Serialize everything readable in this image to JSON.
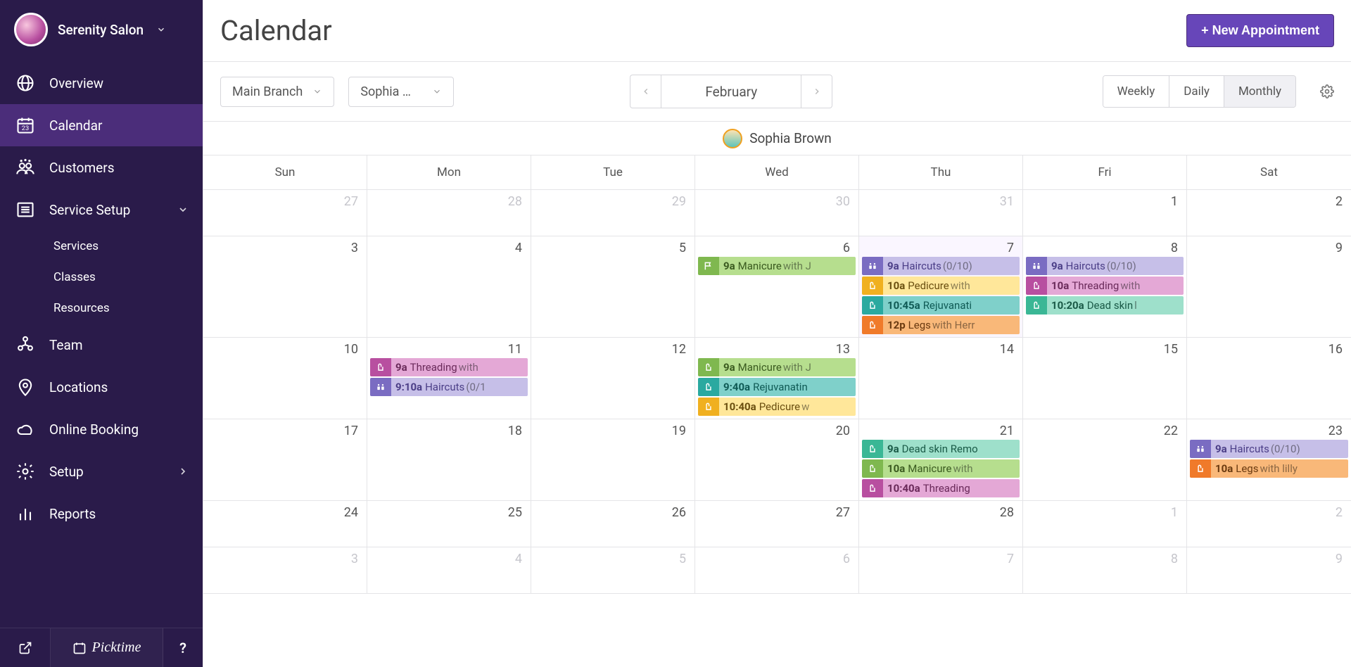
{
  "brand": {
    "name": "Serenity Salon"
  },
  "sidebar": {
    "items": [
      {
        "label": "Overview",
        "icon": "globe"
      },
      {
        "label": "Calendar",
        "icon": "calendar",
        "active": true
      },
      {
        "label": "Customers",
        "icon": "customers"
      },
      {
        "label": "Service Setup",
        "icon": "service",
        "expandable": true,
        "expanded": true
      },
      {
        "label": "Team",
        "icon": "team"
      },
      {
        "label": "Locations",
        "icon": "location"
      },
      {
        "label": "Online Booking",
        "icon": "cloud"
      },
      {
        "label": "Setup",
        "icon": "gear",
        "expandable": true
      },
      {
        "label": "Reports",
        "icon": "reports"
      }
    ],
    "sub": [
      {
        "label": "Services"
      },
      {
        "label": "Classes"
      },
      {
        "label": "Resources"
      }
    ],
    "footer_brand": "Picktime"
  },
  "header": {
    "title": "Calendar",
    "new_appointment": "+ New Appointment"
  },
  "filters": {
    "branch": "Main Branch",
    "staff": "Sophia …",
    "month": "February",
    "views": [
      "Weekly",
      "Daily",
      "Monthly"
    ],
    "active_view": "Monthly"
  },
  "staff_bar": {
    "name": "Sophia Brown"
  },
  "calendar": {
    "day_headers": [
      "Sun",
      "Mon",
      "Tue",
      "Wed",
      "Thu",
      "Fri",
      "Sat"
    ],
    "weeks": [
      [
        {
          "n": "27",
          "muted": true
        },
        {
          "n": "28",
          "muted": true
        },
        {
          "n": "29",
          "muted": true
        },
        {
          "n": "30",
          "muted": true
        },
        {
          "n": "31",
          "muted": true
        },
        {
          "n": "1"
        },
        {
          "n": "2"
        }
      ],
      [
        {
          "n": "3"
        },
        {
          "n": "4"
        },
        {
          "n": "5"
        },
        {
          "n": "6",
          "events": [
            {
              "c": "green",
              "i": "flag",
              "t": "9a",
              "x": "Manicure",
              "w": "with J"
            }
          ]
        },
        {
          "n": "7",
          "today": true,
          "events": [
            {
              "c": "lav",
              "i": "class",
              "t": "9a",
              "x": "Haircuts",
              "w": "(0/10)"
            },
            {
              "c": "yellow",
              "i": "thumb",
              "t": "10a",
              "x": "Pedicure",
              "w": "with"
            },
            {
              "c": "teal",
              "i": "thumb",
              "t": "10:45a",
              "x": "Rejuvanati",
              "w": ""
            },
            {
              "c": "orange",
              "i": "thumb",
              "t": "12p",
              "x": "Legs",
              "w": "with Herr"
            }
          ]
        },
        {
          "n": "8",
          "events": [
            {
              "c": "lav",
              "i": "class",
              "t": "9a",
              "x": "Haircuts",
              "w": "(0/10)"
            },
            {
              "c": "mag",
              "i": "thumb",
              "t": "10a",
              "x": "Threading",
              "w": "with"
            },
            {
              "c": "mint",
              "i": "thumb",
              "t": "10:20a",
              "x": "Dead skin",
              "w": "l"
            }
          ]
        },
        {
          "n": "9"
        }
      ],
      [
        {
          "n": "10"
        },
        {
          "n": "11",
          "events": [
            {
              "c": "mag",
              "i": "thumb",
              "t": "9a",
              "x": "Threading",
              "w": "with"
            },
            {
              "c": "lav",
              "i": "class",
              "t": "9:10a",
              "x": "Haircuts",
              "w": "(0/1"
            }
          ]
        },
        {
          "n": "12"
        },
        {
          "n": "13",
          "events": [
            {
              "c": "green",
              "i": "thumb",
              "t": "9a",
              "x": "Manicure",
              "w": "with J"
            },
            {
              "c": "teal",
              "i": "thumb",
              "t": "9:40a",
              "x": "Rejuvanatin",
              "w": ""
            },
            {
              "c": "yellow",
              "i": "thumb",
              "t": "10:40a",
              "x": "Pedicure",
              "w": "w"
            }
          ]
        },
        {
          "n": "14"
        },
        {
          "n": "15"
        },
        {
          "n": "16"
        }
      ],
      [
        {
          "n": "17"
        },
        {
          "n": "18"
        },
        {
          "n": "19"
        },
        {
          "n": "20"
        },
        {
          "n": "21",
          "events": [
            {
              "c": "mint",
              "i": "thumb",
              "t": "9a",
              "x": "Dead skin Remo",
              "w": ""
            },
            {
              "c": "green",
              "i": "thumb",
              "t": "10a",
              "x": "Manicure",
              "w": "with"
            },
            {
              "c": "mag",
              "i": "thumb",
              "t": "10:40a",
              "x": "Threading",
              "w": ""
            }
          ]
        },
        {
          "n": "22"
        },
        {
          "n": "23",
          "events": [
            {
              "c": "lav",
              "i": "class",
              "t": "9a",
              "x": "Haircuts",
              "w": "(0/10)"
            },
            {
              "c": "orange",
              "i": "thumb",
              "t": "10a",
              "x": "Legs",
              "w": "with lilly"
            }
          ]
        }
      ],
      [
        {
          "n": "24"
        },
        {
          "n": "25"
        },
        {
          "n": "26"
        },
        {
          "n": "27"
        },
        {
          "n": "28"
        },
        {
          "n": "1",
          "muted": true
        },
        {
          "n": "2",
          "muted": true
        }
      ],
      [
        {
          "n": "3",
          "muted": true
        },
        {
          "n": "4",
          "muted": true
        },
        {
          "n": "5",
          "muted": true
        },
        {
          "n": "6",
          "muted": true
        },
        {
          "n": "7",
          "muted": true
        },
        {
          "n": "8",
          "muted": true
        },
        {
          "n": "9",
          "muted": true
        }
      ]
    ]
  }
}
